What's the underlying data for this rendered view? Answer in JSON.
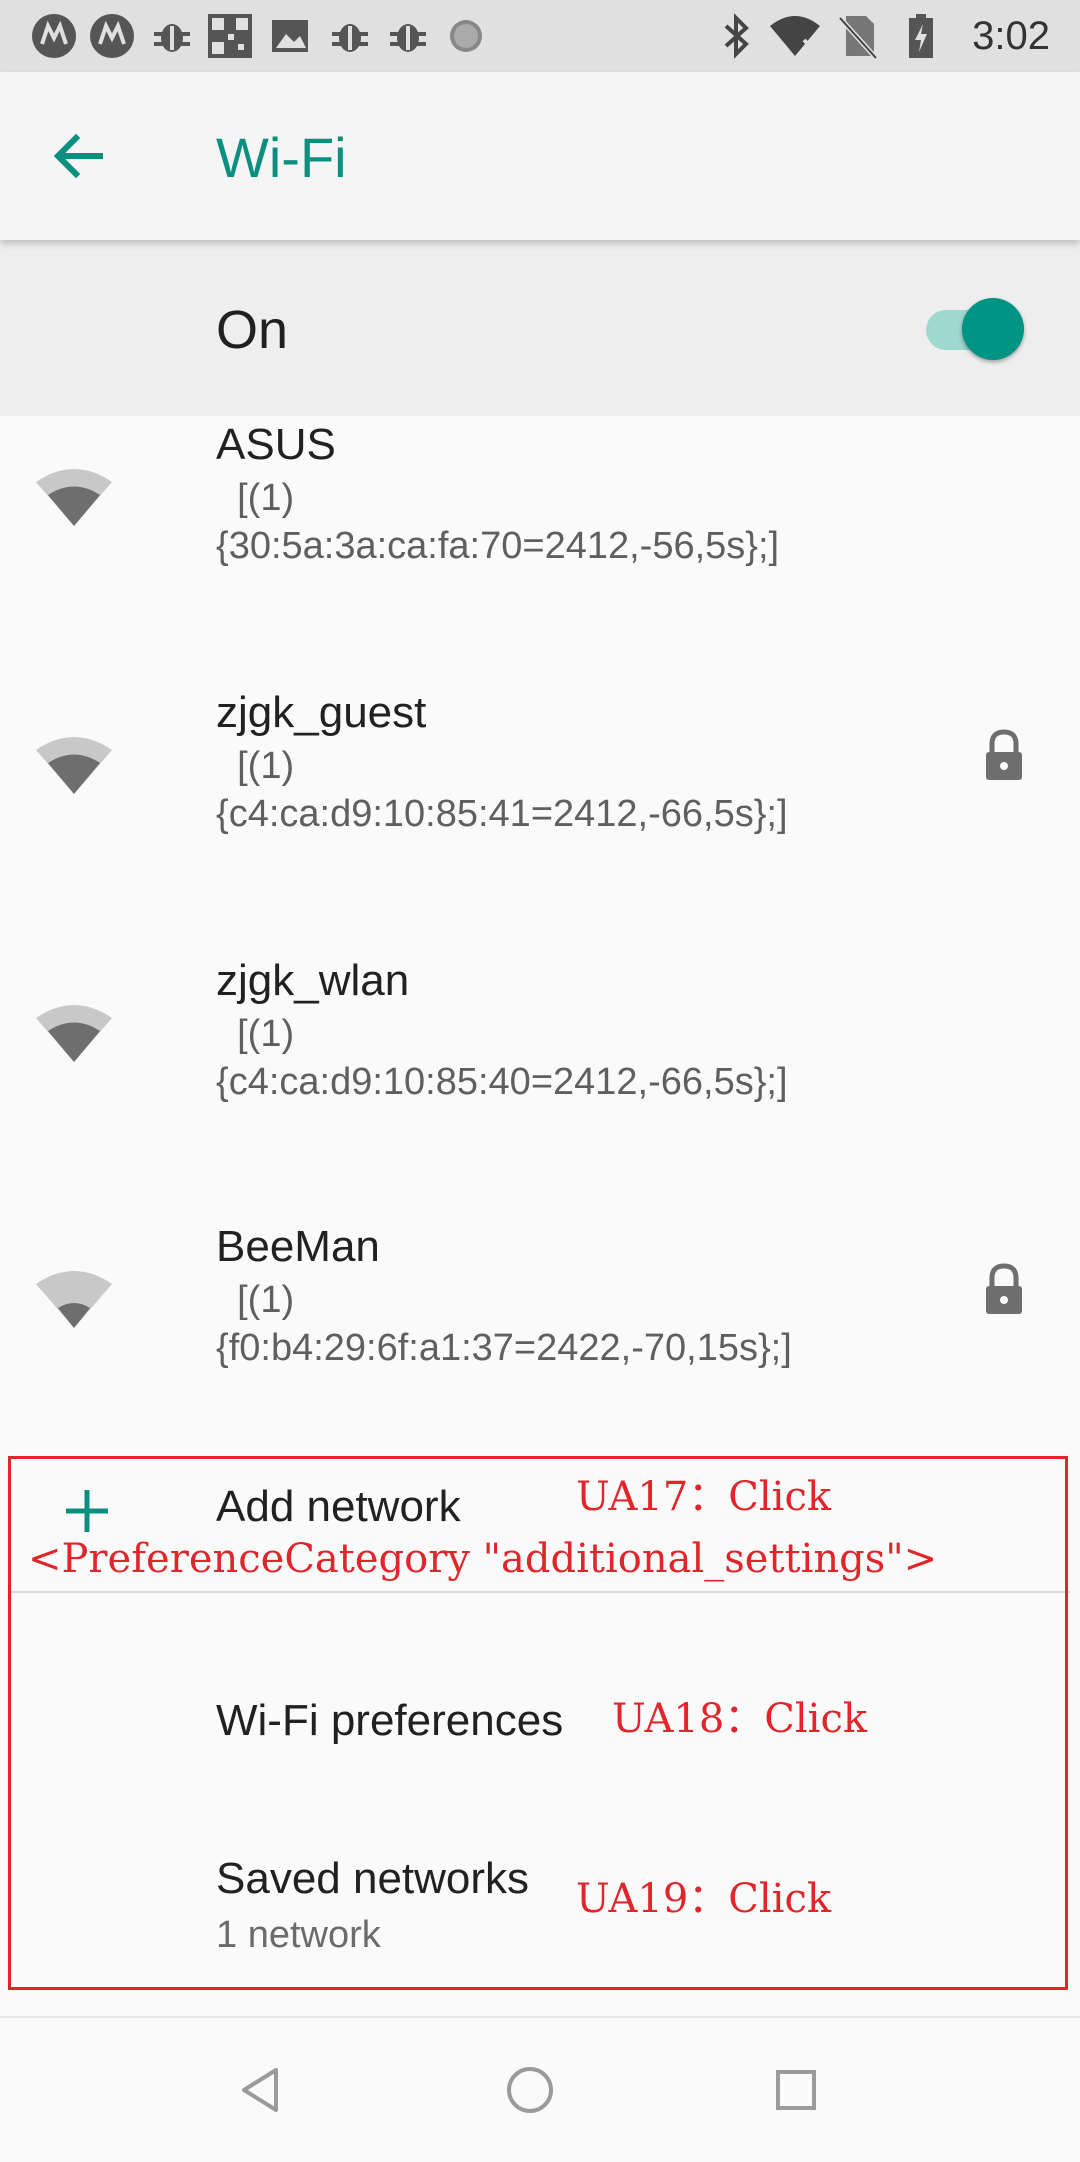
{
  "status_bar": {
    "time": "3:02",
    "left_icons": [
      "motorola-icon",
      "motorola-icon",
      "bug-icon",
      "qr-code-icon",
      "image-icon",
      "bug-icon",
      "bug-icon",
      "loading-icon"
    ],
    "right_icons": [
      "bluetooth-icon",
      "wifi-no-internet-icon",
      "no-sim-icon",
      "battery-charging-icon"
    ]
  },
  "app_bar": {
    "title": "Wi-Fi",
    "accent_color": "#0b8f7e"
  },
  "master_switch": {
    "label": "On",
    "checked": true
  },
  "networks": [
    {
      "ssid": "ASUS",
      "detail": "  [(1)\n{30:5a:3a:ca:fa:70=2412,-56,5s};]",
      "secured": false
    },
    {
      "ssid": "zjgk_guest",
      "detail": "  [(1)\n{c4:ca:d9:10:85:41=2412,-66,5s};]",
      "secured": true
    },
    {
      "ssid": "zjgk_wlan",
      "detail": "  [(1)\n{c4:ca:d9:10:85:40=2412,-66,5s};]",
      "secured": false
    },
    {
      "ssid": "BeeMan",
      "detail": "  [(1)\n{f0:b4:29:6f:a1:37=2422,-70,15s};]",
      "secured": true
    }
  ],
  "additional": {
    "add_network": "Add network",
    "wifi_preferences": "Wi-Fi preferences",
    "saved_networks": "Saved networks",
    "saved_networks_summary": "1 network"
  },
  "annotations": {
    "ua17": "UA17：Click",
    "category": "<PreferenceCategory \"additional_settings\">",
    "ua18": "UA18：Click",
    "ua19": "UA19：Click",
    "color": "#e0262b"
  }
}
